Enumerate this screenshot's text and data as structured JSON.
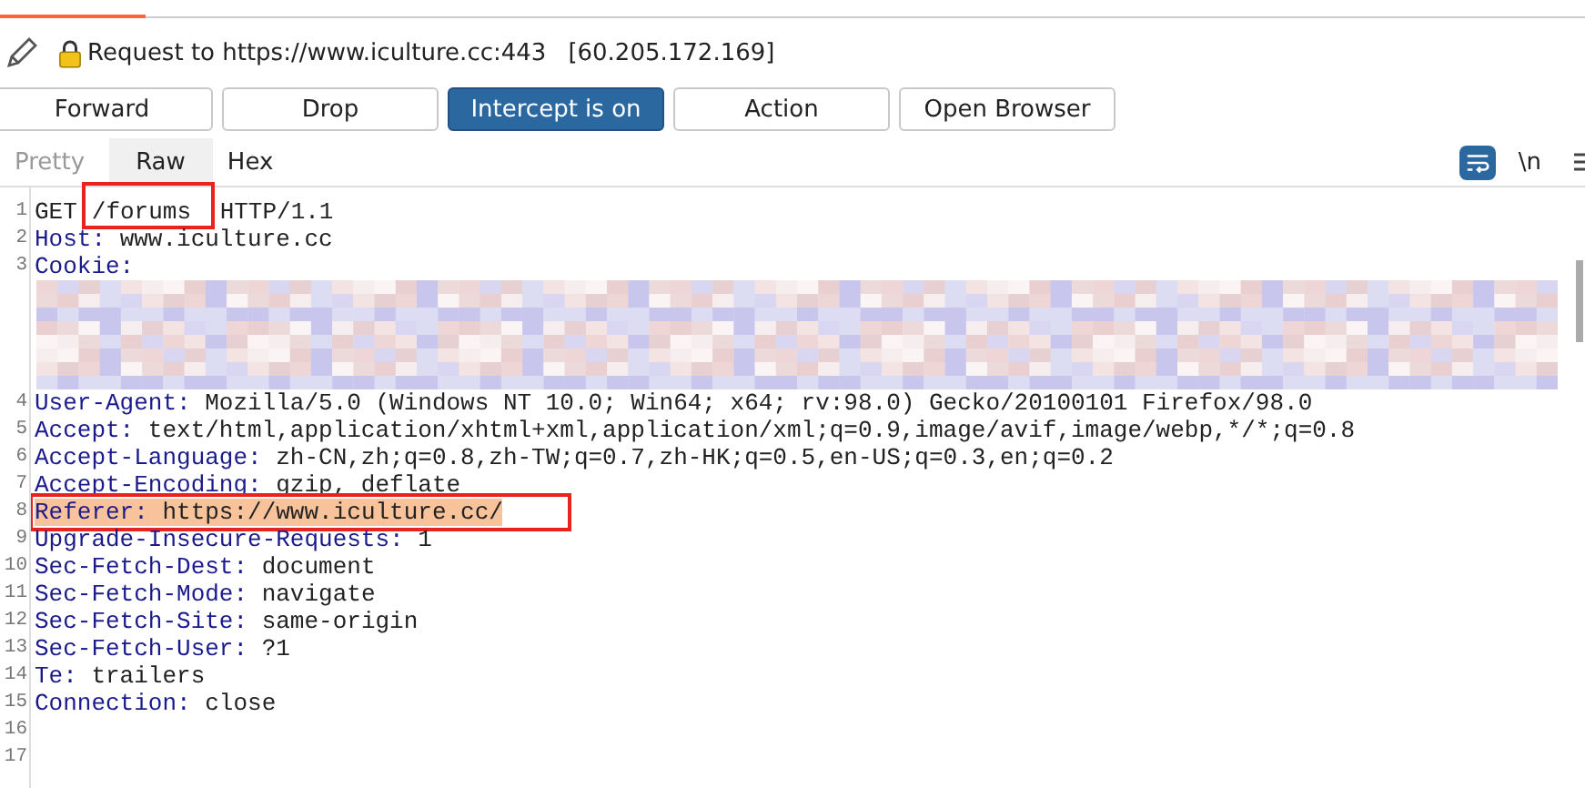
{
  "request": {
    "title": "Request to https://www.iculture.cc:443",
    "ip": "[60.205.172.169]"
  },
  "buttons": [
    {
      "label": "Forward",
      "selected": false
    },
    {
      "label": "Drop",
      "selected": false
    },
    {
      "label": "Intercept is on",
      "selected": true
    },
    {
      "label": "Action",
      "selected": false
    },
    {
      "label": "Open Browser",
      "selected": false
    }
  ],
  "view_tabs": [
    {
      "label": "Pretty",
      "selected": false,
      "disabled": true
    },
    {
      "label": "Raw",
      "selected": true,
      "disabled": false
    },
    {
      "label": "Hex",
      "selected": false,
      "disabled": false
    }
  ],
  "toolbar": {
    "wrap_on": true,
    "newline_toggle": "\\n"
  },
  "lines": [
    {
      "number": "1",
      "kind": "request_line",
      "method": "GET",
      "path": "/forums",
      "version": "HTTP/1.1",
      "annotated": true,
      "highlighted": false
    },
    {
      "number": "2",
      "kind": "header",
      "name": "Host:",
      "value": "www.iculture.cc",
      "annotated": false,
      "highlighted": false
    },
    {
      "number": "3",
      "kind": "redacted",
      "name": "Cookie:",
      "annotated": false,
      "highlighted": false
    },
    {
      "number": "4",
      "kind": "header",
      "name": "User-Agent:",
      "value": "Mozilla/5.0 (Windows NT 10.0; Win64; x64; rv:98.0) Gecko/20100101 Firefox/98.0",
      "annotated": false,
      "highlighted": false
    },
    {
      "number": "5",
      "kind": "header",
      "name": "Accept:",
      "value": "text/html,application/xhtml+xml,application/xml;q=0.9,image/avif,image/webp,*/*;q=0.8",
      "annotated": false,
      "highlighted": false
    },
    {
      "number": "6",
      "kind": "header",
      "name": "Accept-Language:",
      "value": "zh-CN,zh;q=0.8,zh-TW;q=0.7,zh-HK;q=0.5,en-US;q=0.3,en;q=0.2",
      "annotated": false,
      "highlighted": false
    },
    {
      "number": "7",
      "kind": "header",
      "name": "Accept-Encoding:",
      "value": "gzip, deflate",
      "annotated": false,
      "highlighted": false
    },
    {
      "number": "8",
      "kind": "header",
      "name": "Referer:",
      "value": "https://www.iculture.cc/",
      "annotated": true,
      "highlighted": true
    },
    {
      "number": "9",
      "kind": "header",
      "name": "Upgrade-Insecure-Requests:",
      "value": "1",
      "annotated": false,
      "highlighted": false
    },
    {
      "number": "10",
      "kind": "header",
      "name": "Sec-Fetch-Dest:",
      "value": "document",
      "annotated": false,
      "highlighted": false
    },
    {
      "number": "11",
      "kind": "header",
      "name": "Sec-Fetch-Mode:",
      "value": "navigate",
      "annotated": false,
      "highlighted": false
    },
    {
      "number": "12",
      "kind": "header",
      "name": "Sec-Fetch-Site:",
      "value": "same-origin",
      "annotated": false,
      "highlighted": false
    },
    {
      "number": "13",
      "kind": "header",
      "name": "Sec-Fetch-User:",
      "value": "?1",
      "annotated": false,
      "highlighted": false
    },
    {
      "number": "14",
      "kind": "header",
      "name": "Te:",
      "value": "trailers",
      "annotated": false,
      "highlighted": false
    },
    {
      "number": "15",
      "kind": "header",
      "name": "Connection:",
      "value": "close",
      "annotated": false,
      "highlighted": false
    },
    {
      "number": "16",
      "kind": "empty",
      "annotated": false,
      "highlighted": false
    },
    {
      "number": "17",
      "kind": "empty",
      "annotated": false,
      "highlighted": false
    }
  ]
}
